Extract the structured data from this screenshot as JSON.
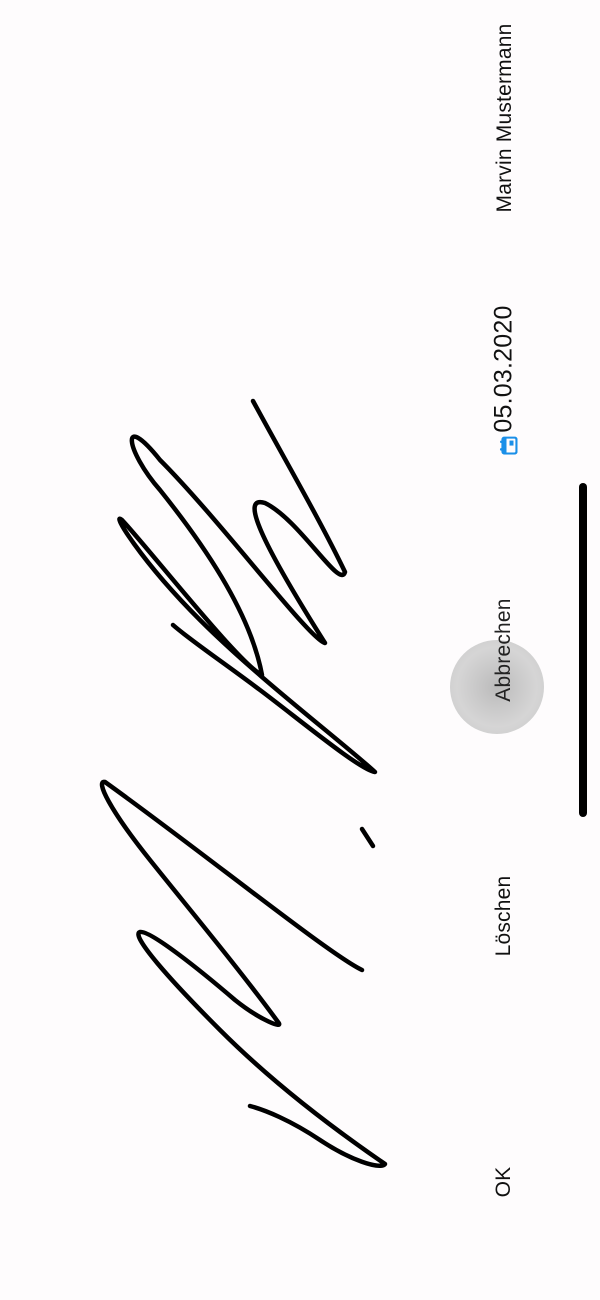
{
  "signer": {
    "name": "Marvin Mustermann"
  },
  "date": {
    "value": "05.03.2020",
    "icon": "calendar-icon",
    "icon_color": "#1a8fe8"
  },
  "actions": {
    "cancel_label": "Abbrechen",
    "clear_label": "Löschen",
    "ok_label": "OK"
  },
  "signature": {
    "stroke_color": "#000000"
  }
}
